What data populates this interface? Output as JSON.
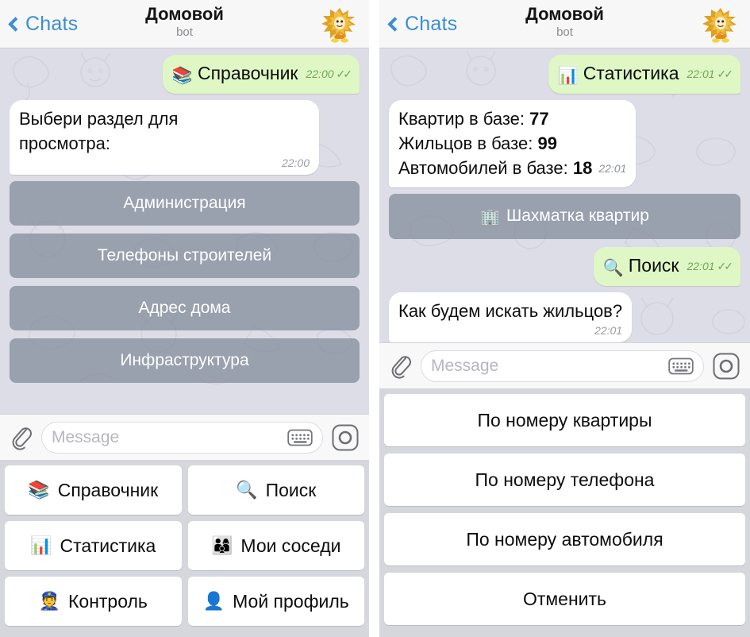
{
  "header": {
    "back_label": "Chats",
    "title": "Домовой",
    "subtitle": "bot",
    "avatar_name": "bot-avatar-domovoi",
    "back_color": "#3b8ed4"
  },
  "colors": {
    "chat_background": "#dcdde6",
    "outgoing_bubble": "#dff7c4",
    "incoming_bubble": "#ffffff",
    "inline_button": "#868e9e",
    "accent_blue": "#3b8ed4",
    "tick_green": "#5fa44a"
  },
  "left": {
    "messages": [
      {
        "dir": "out",
        "emoji": "📚",
        "icon_name": "books-icon",
        "text": "Справочник",
        "time": "22:00",
        "ticks": "✓✓"
      },
      {
        "dir": "in",
        "line1": "Выбери раздел для",
        "line2": "просмотра:",
        "time": "22:00"
      }
    ],
    "inline_buttons": [
      {
        "label": "Администрация"
      },
      {
        "label": "Телефоны строителей"
      },
      {
        "label": "Адрес дома"
      },
      {
        "label": "Инфраструктура"
      }
    ],
    "input": {
      "placeholder": "Message",
      "attach_icon": "paperclip-icon",
      "keyboard_icon": "keyboard-icon",
      "record_icon": "record-voice-icon"
    },
    "reply_keyboard": [
      [
        {
          "emoji": "📚",
          "icon_name": "books-icon",
          "label": "Справочник"
        },
        {
          "emoji": "🔍",
          "icon_name": "magnifier-icon",
          "label": "Поиск"
        }
      ],
      [
        {
          "emoji": "📊",
          "icon_name": "bar-chart-icon",
          "label": "Статистика"
        },
        {
          "emoji": "👨‍👩‍👦",
          "icon_name": "family-icon",
          "label": "Мои соседи"
        }
      ],
      [
        {
          "emoji": "👮",
          "icon_name": "police-officer-icon",
          "label": "Контроль"
        },
        {
          "emoji": "👤",
          "icon_name": "person-icon",
          "label": "Мой профиль"
        }
      ]
    ]
  },
  "right": {
    "messages": [
      {
        "dir": "out",
        "emoji": "📊",
        "icon_name": "bar-chart-icon",
        "text": "Статистика",
        "time": "22:01",
        "ticks": "✓✓"
      },
      {
        "dir": "in",
        "stats": [
          {
            "label": "Квартир в базе:",
            "value": "77"
          },
          {
            "label": "Жильцов в базе:",
            "value": "99"
          },
          {
            "label": "Автомобилей в базе:",
            "value": "18"
          }
        ],
        "time": "22:01"
      },
      {
        "dir": "out",
        "emoji": "🔍",
        "icon_name": "magnifier-icon",
        "text": "Поиск",
        "time": "22:01",
        "ticks": "✓✓"
      },
      {
        "dir": "in",
        "line1": "Как будем искать жильцов?",
        "time": "22:01"
      }
    ],
    "inline_buttons": [
      {
        "emoji": "🏢",
        "icon_name": "building-grid-icon",
        "label": "Шахматка квартир"
      }
    ],
    "input": {
      "placeholder": "Message",
      "attach_icon": "paperclip-icon",
      "keyboard_icon": "keyboard-icon",
      "record_icon": "record-voice-icon"
    },
    "reply_keyboard": [
      {
        "label": "По номеру квартиры"
      },
      {
        "label": "По номеру телефона"
      },
      {
        "label": "По номеру автомобиля"
      },
      {
        "label": "Отменить"
      }
    ]
  }
}
